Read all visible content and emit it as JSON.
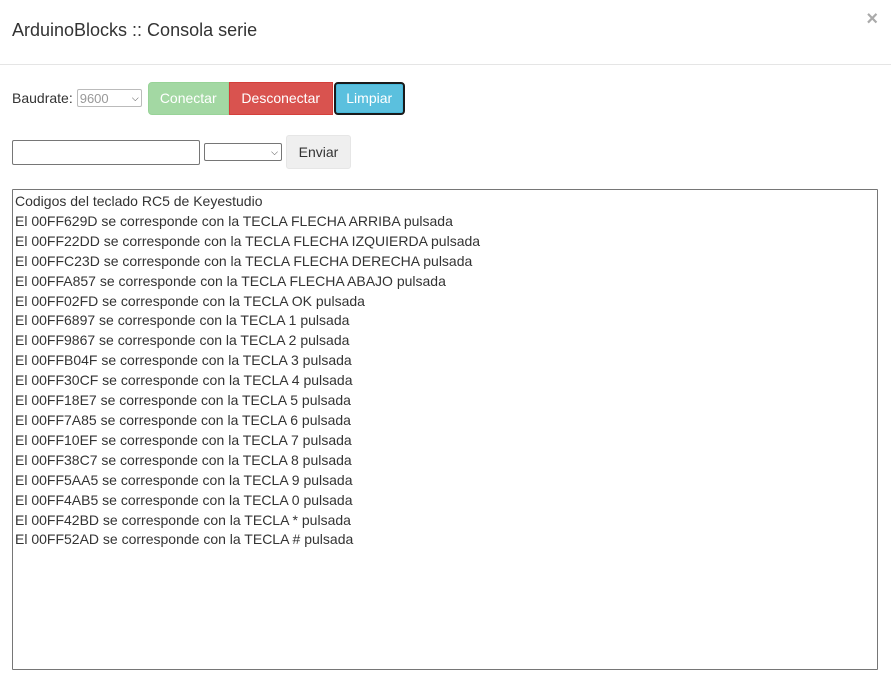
{
  "header": {
    "title": "ArduinoBlocks :: Consola serie",
    "close_symbol": "×"
  },
  "controls": {
    "baud_label": "Baudrate:",
    "baud_value": "9600",
    "connect_label": "Conectar",
    "disconnect_label": "Desconectar",
    "clear_label": "Limpiar"
  },
  "send": {
    "input_value": "",
    "mode_value": "",
    "send_label": "Enviar"
  },
  "console": {
    "lines": [
      "Codigos del teclado RC5 de Keyestudio",
      "El 00FF629D se corresponde con la TECLA FLECHA ARRIBA pulsada",
      "El 00FF22DD se corresponde con la TECLA FLECHA IZQUIERDA pulsada",
      "El 00FFC23D se corresponde con la TECLA FLECHA DERECHA pulsada",
      "El 00FFA857 se corresponde con la TECLA FLECHA ABAJO pulsada",
      "El 00FF02FD se corresponde con la TECLA OK pulsada",
      "El 00FF6897 se corresponde con la TECLA 1 pulsada",
      "El 00FF9867 se corresponde con la TECLA 2 pulsada",
      "El 00FFB04F se corresponde con la TECLA 3 pulsada",
      "El 00FF30CF se corresponde con la TECLA 4 pulsada",
      "El 00FF18E7 se corresponde con la TECLA 5 pulsada",
      "El 00FF7A85 se corresponde con la TECLA 6 pulsada",
      "El 00FF10EF se corresponde con la TECLA 7 pulsada",
      "El 00FF38C7 se corresponde con la TECLA 8 pulsada",
      "El 00FF5AA5 se corresponde con la TECLA 9 pulsada",
      "El 00FF4AB5 se corresponde con la TECLA 0 pulsada",
      "El 00FF42BD se corresponde con la TECLA * pulsada",
      "El 00FF52AD se corresponde con la TECLA # pulsada"
    ]
  }
}
